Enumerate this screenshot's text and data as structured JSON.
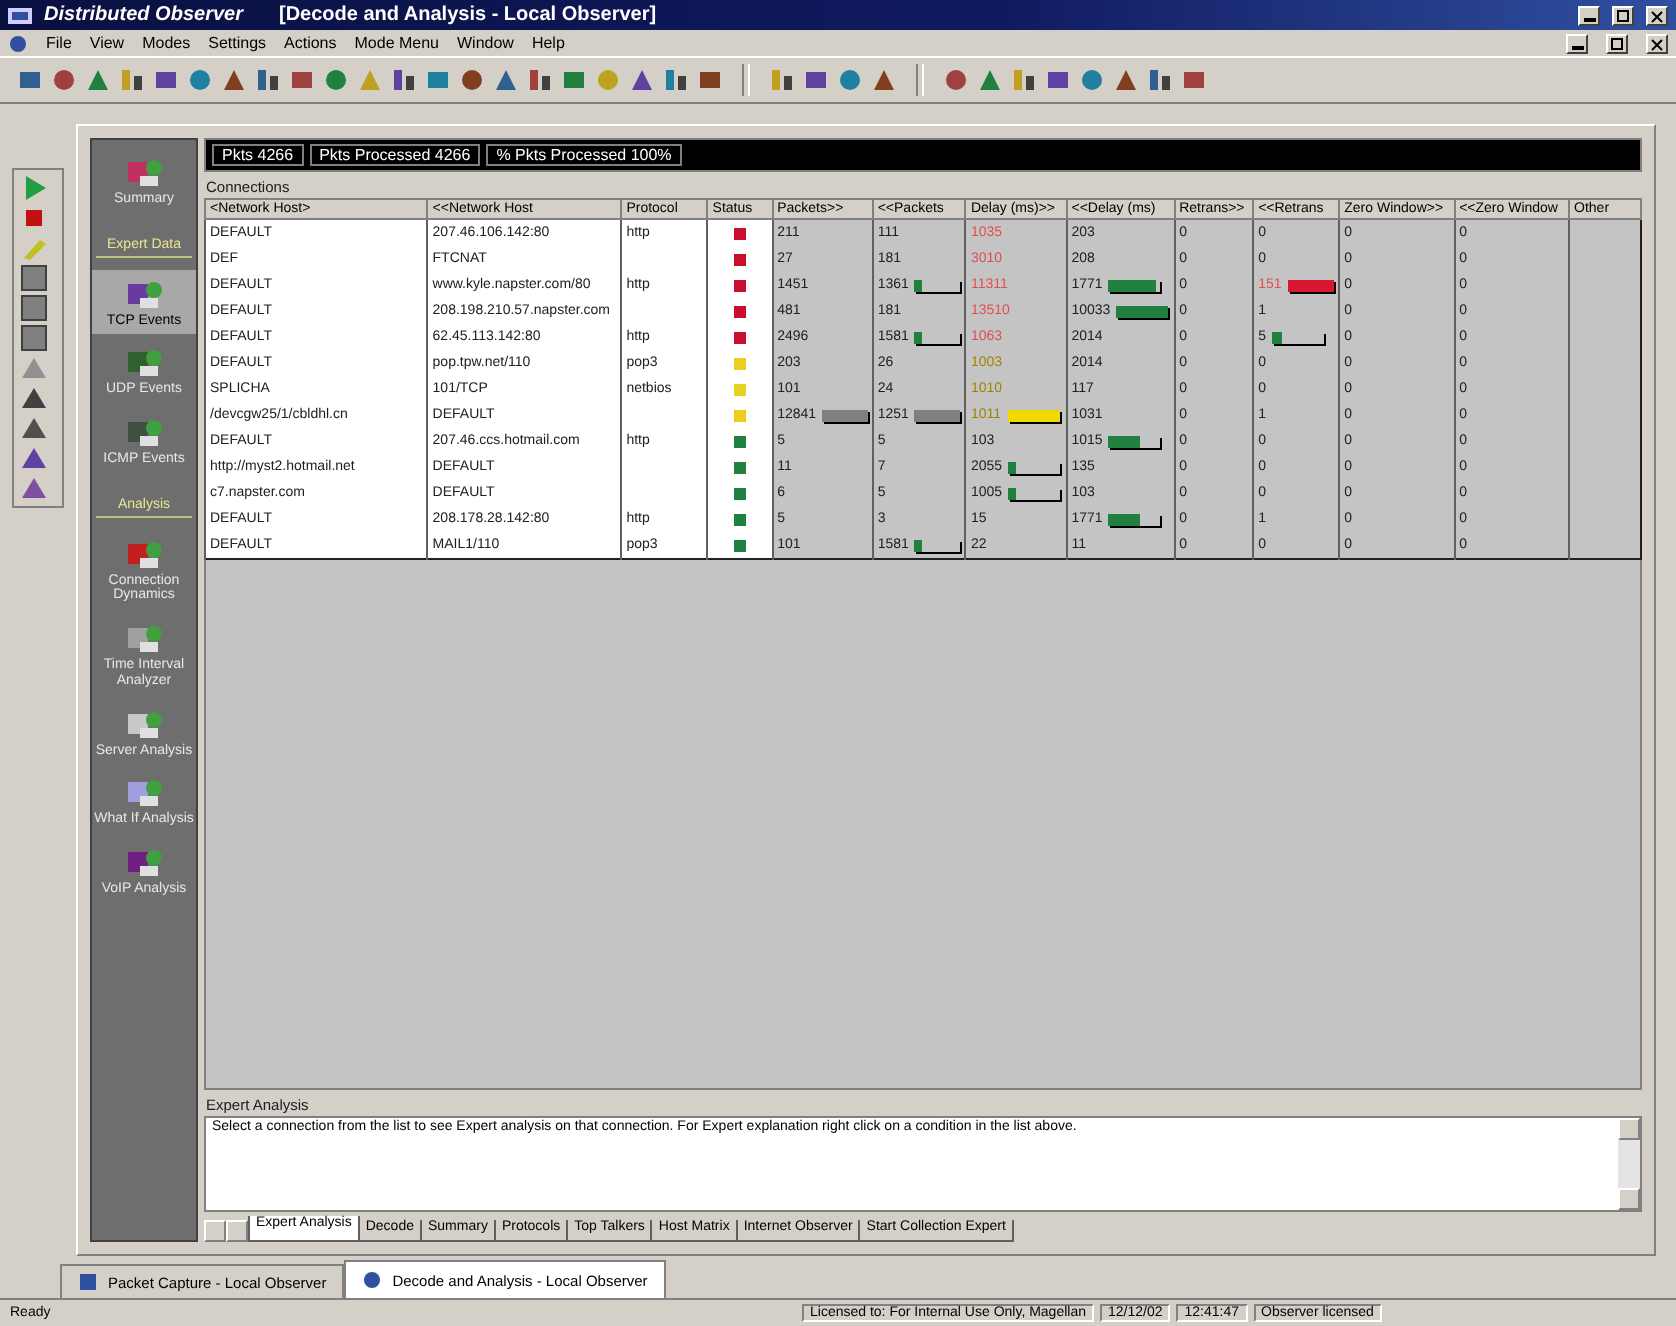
{
  "window": {
    "app_title": "Distributed Observer",
    "doc_title": "[Decode and Analysis - Local Observer]"
  },
  "menu": [
    "File",
    "View",
    "Modes",
    "Settings",
    "Actions",
    "Mode Menu",
    "Window",
    "Help"
  ],
  "outlook": {
    "top_items": [
      {
        "label": "Summary",
        "selected": false
      }
    ],
    "sections": [
      {
        "title": "Expert Data",
        "items": [
          {
            "label": "TCP Events",
            "selected": true
          },
          {
            "label": "UDP Events",
            "selected": false
          },
          {
            "label": "ICMP Events",
            "selected": false
          }
        ]
      },
      {
        "title": "Analysis",
        "items": [
          {
            "label": "Connection Dynamics",
            "selected": false
          },
          {
            "label": "Time Interval Analyzer",
            "selected": false
          },
          {
            "label": "Server Analysis",
            "selected": false
          },
          {
            "label": "What If Analysis",
            "selected": false
          },
          {
            "label": "VoIP Analysis",
            "selected": false
          }
        ]
      }
    ]
  },
  "stats": [
    "Pkts 4266",
    "Pkts Processed 4266",
    "% Pkts Processed 100%"
  ],
  "connections": {
    "label": "Connections",
    "columns": [
      "<Network Host>",
      "<<Network Host",
      "Protocol",
      "Status",
      "Packets>>",
      "<<Packets",
      "Delay (ms)>>",
      "<<Delay (ms)",
      "Retrans>>",
      "<<Retrans",
      "Zero Window>>",
      "<<Zero Window",
      "Other"
    ],
    "rows": [
      {
        "host": "DEFAULT",
        "peer": "207.46.106.142:80",
        "protocol": "http",
        "color": "#c8102e",
        "metrics": [
          {
            "text": "211"
          },
          {
            "text": "111"
          },
          {
            "text": "1035",
            "color": "#e05050"
          },
          {
            "text": "203"
          },
          {
            "text": "0"
          },
          {
            "text": "0"
          },
          {
            "text": "0"
          },
          {
            "text": "0"
          }
        ]
      },
      {
        "host": "DEF",
        "peer": "FTCNAT",
        "color": "#c8102e",
        "metrics": [
          {
            "text": "27"
          },
          {
            "text": "181"
          },
          {
            "text": "3010",
            "color": "#e05050"
          },
          {
            "text": "208"
          },
          {
            "text": "0"
          },
          {
            "text": "0"
          },
          {
            "text": "0"
          },
          {
            "text": "0"
          }
        ]
      },
      {
        "host": "DEFAULT",
        "peer": "www.kyle.napster.com/80",
        "protocol": "http",
        "color": "#c8102e",
        "metrics": [
          {
            "text": "1451"
          },
          {
            "text": "1361",
            "bar": {
              "color": "#208040",
              "level": 0.15
            }
          },
          {
            "text": "11311",
            "color": "#e05050"
          },
          {
            "text": "1771",
            "bar": {
              "color": "#208040",
              "level": 0.9
            }
          },
          {
            "text": "0"
          },
          {
            "text": "151",
            "color": "#e05050",
            "bar": {
              "color": "#d81830",
              "level": 1
            }
          },
          {
            "text": "0"
          },
          {
            "text": "0"
          }
        ]
      },
      {
        "host": "DEFAULT",
        "peer": "208.198.210.57.napster.com",
        "color": "#c8102e",
        "metrics": [
          {
            "text": "481"
          },
          {
            "text": "181"
          },
          {
            "text": "13510",
            "color": "#e05050"
          },
          {
            "text": "10033",
            "bar": {
              "color": "#208040",
              "level": 1
            }
          },
          {
            "text": "0"
          },
          {
            "text": "1"
          },
          {
            "text": "0"
          },
          {
            "text": "0"
          }
        ]
      },
      {
        "host": "DEFAULT",
        "peer": "62.45.113.142:80",
        "protocol": "http",
        "color": "#c8102e",
        "metrics": [
          {
            "text": "2496"
          },
          {
            "text": "1581",
            "bar": {
              "color": "#208040",
              "level": 0.15
            }
          },
          {
            "text": "1063",
            "color": "#e05050"
          },
          {
            "text": "2014"
          },
          {
            "text": "0"
          },
          {
            "text": "5",
            "bar": {
              "color": "#208040",
              "level": 0.2
            }
          },
          {
            "text": "0"
          },
          {
            "text": "0"
          }
        ]
      },
      {
        "host": "DEFAULT",
        "peer": "pop.tpw.net/110",
        "protocol": "pop3",
        "color": "#e8d020",
        "metrics": [
          {
            "text": "203"
          },
          {
            "text": "26"
          },
          {
            "text": "1003",
            "color": "#a08400"
          },
          {
            "text": "2014"
          },
          {
            "text": "0"
          },
          {
            "text": "0"
          },
          {
            "text": "0"
          },
          {
            "text": "0"
          }
        ]
      },
      {
        "host": "SPLICHA",
        "peer": "101/TCP",
        "protocol": "netbios",
        "color": "#e8d020",
        "metrics": [
          {
            "text": "101"
          },
          {
            "text": "24"
          },
          {
            "text": "1010",
            "color": "#a08400"
          },
          {
            "text": "117"
          },
          {
            "text": "0"
          },
          {
            "text": "0"
          },
          {
            "text": "0"
          },
          {
            "text": "0"
          }
        ]
      },
      {
        "host": "/devcgw25/1/cbldhl.cn",
        "peer": "DEFAULT",
        "color": "#e8d020",
        "metrics": [
          {
            "text": "12841",
            "bar": {
              "color": "#808080",
              "level": 1
            }
          },
          {
            "text": "1251",
            "bar": {
              "color": "#808080",
              "level": 1
            }
          },
          {
            "text": "1011",
            "color": "#a08400",
            "bar": {
              "color": "#f0d800",
              "level": 1
            }
          },
          {
            "text": "1031"
          },
          {
            "text": "0"
          },
          {
            "text": "1"
          },
          {
            "text": "0"
          },
          {
            "text": "0"
          }
        ]
      },
      {
        "host": "DEFAULT",
        "peer": "207.46.ccs.hotmail.com",
        "protocol": "http",
        "color": "#208040",
        "metrics": [
          {
            "text": "5"
          },
          {
            "text": "5"
          },
          {
            "text": "103"
          },
          {
            "text": "1015",
            "bar": {
              "color": "#208040",
              "level": 0.6
            }
          },
          {
            "text": "0"
          },
          {
            "text": "0"
          },
          {
            "text": "0"
          },
          {
            "text": "0"
          }
        ]
      },
      {
        "host": "http://myst2.hotmail.net",
        "peer": "DEFAULT",
        "color": "#208040",
        "metrics": [
          {
            "text": "11"
          },
          {
            "text": "7"
          },
          {
            "text": "2055",
            "bar": {
              "color": "#208040",
              "level": 0.15
            }
          },
          {
            "text": "135"
          },
          {
            "text": "0"
          },
          {
            "text": "0"
          },
          {
            "text": "0"
          },
          {
            "text": "0"
          }
        ]
      },
      {
        "host": "c7.napster.com",
        "peer": "DEFAULT",
        "color": "#208040",
        "metrics": [
          {
            "text": "6"
          },
          {
            "text": "5"
          },
          {
            "text": "1005",
            "bar": {
              "color": "#208040",
              "level": 0.15
            }
          },
          {
            "text": "103"
          },
          {
            "text": "0"
          },
          {
            "text": "0"
          },
          {
            "text": "0"
          },
          {
            "text": "0"
          }
        ]
      },
      {
        "host": "DEFAULT",
        "peer": "208.178.28.142:80",
        "protocol": "http",
        "color": "#208040",
        "metrics": [
          {
            "text": "5"
          },
          {
            "text": "3"
          },
          {
            "text": "15"
          },
          {
            "text": "1771",
            "bar": {
              "color": "#208040",
              "level": 0.6
            }
          },
          {
            "text": "0"
          },
          {
            "text": "1"
          },
          {
            "text": "0"
          },
          {
            "text": "0"
          }
        ]
      },
      {
        "host": "DEFAULT",
        "peer": "MAIL1/110",
        "protocol": "pop3",
        "color": "#208040",
        "metrics": [
          {
            "text": "101"
          },
          {
            "text": "1581",
            "bar": {
              "color": "#208040",
              "level": 0.15
            }
          },
          {
            "text": "22"
          },
          {
            "text": "11"
          },
          {
            "text": "0"
          },
          {
            "text": "0"
          },
          {
            "text": "0"
          },
          {
            "text": "0"
          }
        ]
      }
    ]
  },
  "expert": {
    "label": "Expert Analysis",
    "text": "Select a connection from the list to see Expert analysis on that connection. For Expert explanation right click on a condition in the list above."
  },
  "sheet_tabs": [
    {
      "label": "Expert Analysis",
      "selected": true
    },
    {
      "label": "Decode",
      "selected": false
    },
    {
      "label": "Summary",
      "selected": false
    },
    {
      "label": "Protocols",
      "selected": false
    },
    {
      "label": "Top Talkers",
      "selected": false
    },
    {
      "label": "Host Matrix",
      "selected": false
    },
    {
      "label": "Internet Observer",
      "selected": false
    },
    {
      "label": "Start Collection Expert",
      "selected": false
    }
  ],
  "doc_tabs": [
    {
      "label": "Packet Capture - Local Observer",
      "selected": false
    },
    {
      "label": "Decode and Analysis - Local Observer",
      "selected": true
    }
  ],
  "status_bar": [
    "Ready",
    "Licensed to: For Internal Use Only, Magellan",
    "12/12/02",
    "12:41:47",
    "Observer licensed"
  ]
}
